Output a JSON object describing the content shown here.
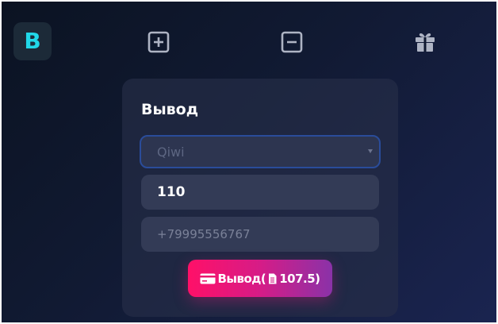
{
  "logo": {
    "letter": "B",
    "color": "#21d7e8"
  },
  "nav": {
    "items": [
      {
        "icon": "plus-square-icon"
      },
      {
        "icon": "minus-square-icon"
      },
      {
        "icon": "gift-icon"
      }
    ]
  },
  "withdraw_card": {
    "title": "Вывод",
    "method_select": {
      "value": "Qiwi"
    },
    "amount_field": {
      "value": "110"
    },
    "wallet_field": {
      "placeholder": "+79995556767"
    },
    "submit": {
      "label_prefix": "Вывод(",
      "amount": "107.5)",
      "icons": [
        "credit-card-icon",
        "document-icon"
      ]
    }
  },
  "colors": {
    "accent": "#21d7e8",
    "button_start": "#ff1068",
    "button_end": "#8a32a8",
    "background": "#111a33"
  }
}
